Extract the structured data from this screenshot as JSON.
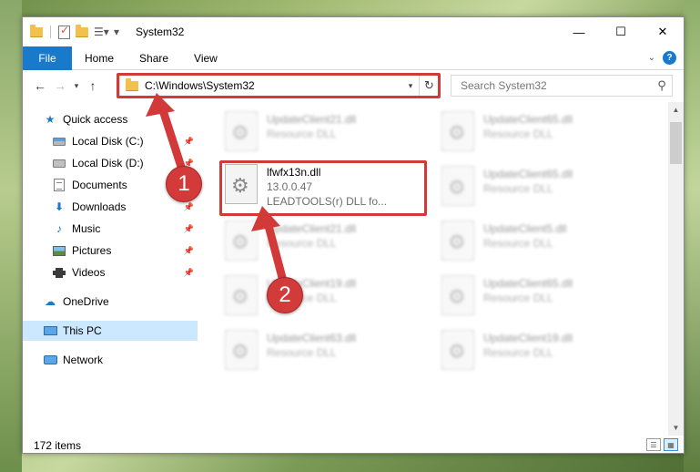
{
  "window": {
    "title": "System32",
    "controls": {
      "minimize": "—",
      "maximize": "☐",
      "close": "✕"
    }
  },
  "ribbon": {
    "tabs": [
      "File",
      "Home",
      "Share",
      "View"
    ],
    "help": "?"
  },
  "address": {
    "path": "C:\\Windows\\System32",
    "search_placeholder": "Search System32"
  },
  "navpane": {
    "items": [
      {
        "label": "Quick access",
        "icon": "star-icon",
        "pinned": false
      },
      {
        "label": "Local Disk (C:)",
        "icon": "local-disk-c-icon",
        "pinned": true
      },
      {
        "label": "Local Disk (D:)",
        "icon": "local-disk-d-icon",
        "pinned": true
      },
      {
        "label": "Documents",
        "icon": "documents-icon",
        "pinned": true
      },
      {
        "label": "Downloads",
        "icon": "downloads-icon",
        "pinned": true
      },
      {
        "label": "Music",
        "icon": "music-icon",
        "pinned": true
      },
      {
        "label": "Pictures",
        "icon": "pictures-icon",
        "pinned": true
      },
      {
        "label": "Videos",
        "icon": "videos-icon",
        "pinned": true
      },
      {
        "label": "OneDrive",
        "icon": "onedrive-icon",
        "pinned": false
      },
      {
        "label": "This PC",
        "icon": "this-pc-icon",
        "pinned": false,
        "selected": true
      },
      {
        "label": "Network",
        "icon": "network-icon",
        "pinned": false
      }
    ]
  },
  "files": [
    {
      "name": "UpdateClient21.dll",
      "sub1": "Resource DLL",
      "sub2": "",
      "blurred": true
    },
    {
      "name": "UpdateClient65.dll",
      "sub1": "Resource DLL",
      "sub2": "",
      "blurred": true
    },
    {
      "name": "lfwfx13n.dll",
      "sub1": "13.0.0.47",
      "sub2": "LEADTOOLS(r) DLL fo...",
      "blurred": false
    },
    {
      "name": "UpdateClient65.dll",
      "sub1": "Resource DLL",
      "sub2": "",
      "blurred": true
    },
    {
      "name": "UpdateClient21.dll",
      "sub1": "Resource DLL",
      "sub2": "",
      "blurred": true
    },
    {
      "name": "UpdateClient5.dll",
      "sub1": "Resource DLL",
      "sub2": "",
      "blurred": true
    },
    {
      "name": "UpdateClient19.dll",
      "sub1": "Resource DLL",
      "sub2": "",
      "blurred": true
    },
    {
      "name": "UpdateClient65.dll",
      "sub1": "Resource DLL",
      "sub2": "",
      "blurred": true
    },
    {
      "name": "UpdateClient63.dll",
      "sub1": "Resource DLL",
      "sub2": "",
      "blurred": true
    },
    {
      "name": "UpdateClient19.dll",
      "sub1": "Resource DLL",
      "sub2": "",
      "blurred": true
    }
  ],
  "status": {
    "item_count": "172 items"
  },
  "annotations": {
    "step1": "1",
    "step2": "2",
    "color": "#d23a3a"
  }
}
